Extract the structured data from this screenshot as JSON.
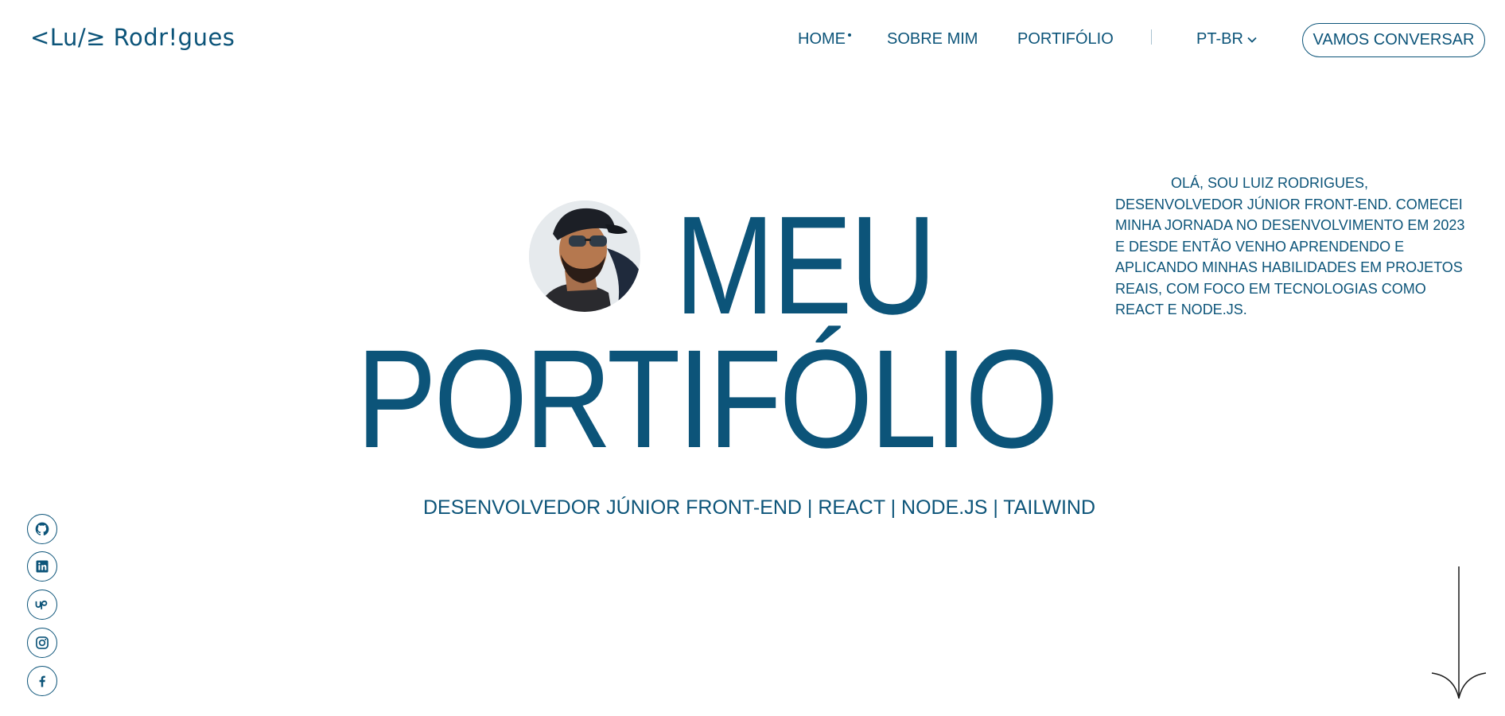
{
  "header": {
    "logo": "<Lu/≥ Rodr!gues",
    "nav": [
      "HOME",
      "SOBRE MIM",
      "PORTIFÓLIO"
    ],
    "language": "PT-BR",
    "cta": "VAMOS CONVERSAR"
  },
  "hero": {
    "line1": "MEU",
    "line2": "PORTIFÓLIO",
    "subtitle": "DESENVOLVEDOR JÚNIOR FRONT-END | REACT | NODE.JS | TAILWIND"
  },
  "about": "OLÁ, SOU LUIZ RODRIGUES, DESENVOLVEDOR JÚNIOR FRONT-END. COMECEI MINHA JORNADA NO DESENVOLVIMENTO EM 2023 E DESDE ENTÃO VENHO APRENDENDO E APLICANDO MINHAS HABILIDADES EM PROJETOS REAIS, COM FOCO EM TECNOLOGIAS COMO REACT E NODE.JS.",
  "social": [
    "github-icon",
    "linkedin-icon",
    "upwork-icon",
    "instagram-icon",
    "facebook-icon"
  ],
  "colors": {
    "primary": "#0c5479",
    "background": "#ffffff"
  }
}
